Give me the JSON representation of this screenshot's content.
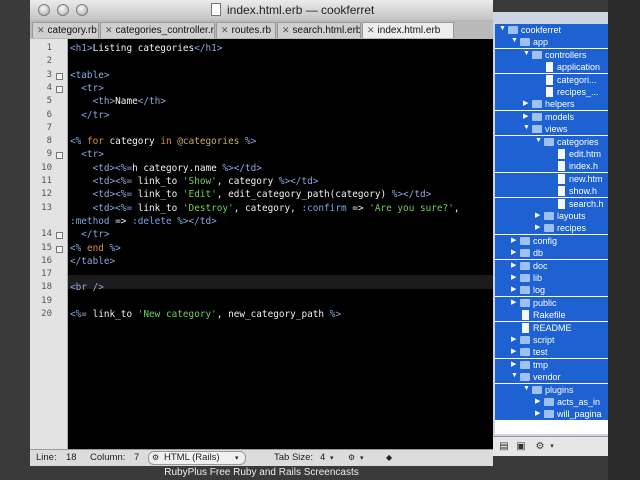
{
  "window": {
    "title": "index.html.erb — cookferret",
    "tabs": [
      {
        "label": "category.rb"
      },
      {
        "label": "categories_controller.rb"
      },
      {
        "label": "routes.rb"
      },
      {
        "label": "search.html.erb"
      },
      {
        "label": "index.html.erb",
        "active": true
      }
    ]
  },
  "editor": {
    "line_numbers": [
      "1",
      "2",
      "3",
      "4",
      "5",
      "6",
      "7",
      "8",
      "9",
      "10",
      "11",
      "12",
      "13",
      "",
      "14",
      "15",
      "16",
      "17",
      "18",
      "19",
      "20"
    ],
    "lines": [
      {
        "parts": [
          {
            "c": "t",
            "x": "<h1>"
          },
          {
            "c": "",
            "x": "Listing categories"
          },
          {
            "c": "t",
            "x": "</h1>"
          }
        ]
      },
      {
        "parts": []
      },
      {
        "parts": [
          {
            "c": "t",
            "x": "<table>"
          }
        ]
      },
      {
        "parts": [
          {
            "c": "t",
            "x": "  <tr>"
          }
        ]
      },
      {
        "parts": [
          {
            "c": "t",
            "x": "    <th>"
          },
          {
            "c": "",
            "x": "Name"
          },
          {
            "c": "t",
            "x": "</th>"
          }
        ]
      },
      {
        "parts": [
          {
            "c": "t",
            "x": "  </tr>"
          }
        ]
      },
      {
        "parts": []
      },
      {
        "parts": [
          {
            "c": "t",
            "x": "<%"
          },
          {
            "c": "k",
            "x": " for "
          },
          {
            "c": "",
            "x": "category "
          },
          {
            "c": "k",
            "x": "in "
          },
          {
            "c": "v",
            "x": "@categories"
          },
          {
            "c": "t",
            "x": " %>"
          }
        ]
      },
      {
        "parts": [
          {
            "c": "t",
            "x": "  <tr>"
          }
        ]
      },
      {
        "parts": [
          {
            "c": "t",
            "x": "    <td><%="
          },
          {
            "c": "",
            "x": "h category.name "
          },
          {
            "c": "t",
            "x": "%></td>"
          }
        ]
      },
      {
        "parts": [
          {
            "c": "t",
            "x": "    <td><%="
          },
          {
            "c": "",
            "x": " link_to "
          },
          {
            "c": "s",
            "x": "'Show'"
          },
          {
            "c": "",
            "x": ", category "
          },
          {
            "c": "t",
            "x": "%></td>"
          }
        ]
      },
      {
        "parts": [
          {
            "c": "t",
            "x": "    <td><%="
          },
          {
            "c": "",
            "x": " link_to "
          },
          {
            "c": "s",
            "x": "'Edit'"
          },
          {
            "c": "",
            "x": ", edit_category_path(category) "
          },
          {
            "c": "t",
            "x": "%></td>"
          }
        ]
      },
      {
        "parts": [
          {
            "c": "t",
            "x": "    <td><%="
          },
          {
            "c": "",
            "x": " link_to "
          },
          {
            "c": "s",
            "x": "'Destroy'"
          },
          {
            "c": "",
            "x": ", category, "
          },
          {
            "c": "sym",
            "x": ":confirm"
          },
          {
            "c": "",
            "x": " => "
          },
          {
            "c": "s",
            "x": "'Are you sure?'"
          },
          {
            "c": "",
            "x": ","
          }
        ]
      },
      {
        "parts": [
          {
            "c": "sym",
            "x": ":method"
          },
          {
            "c": "",
            "x": " => "
          },
          {
            "c": "sym",
            "x": ":delete"
          },
          {
            "c": "t",
            "x": " %></td>"
          }
        ]
      },
      {
        "parts": [
          {
            "c": "t",
            "x": "  </tr>"
          }
        ]
      },
      {
        "parts": [
          {
            "c": "t",
            "x": "<%"
          },
          {
            "c": "k",
            "x": " end "
          },
          {
            "c": "t",
            "x": "%>"
          }
        ]
      },
      {
        "parts": [
          {
            "c": "t",
            "x": "</table>"
          }
        ]
      },
      {
        "parts": []
      },
      {
        "parts": [
          {
            "c": "t",
            "x": "<br />"
          }
        ]
      },
      {
        "parts": []
      },
      {
        "parts": [
          {
            "c": "t",
            "x": "<%="
          },
          {
            "c": "",
            "x": " link_to "
          },
          {
            "c": "s",
            "x": "'New category'"
          },
          {
            "c": "",
            "x": ", new_category_path "
          },
          {
            "c": "t",
            "x": "%>"
          }
        ]
      }
    ]
  },
  "status": {
    "line_label": "Line:",
    "line_value": "18",
    "column_label": "Column:",
    "column_value": "7",
    "language": "HTML (Rails)",
    "tab_size_label": "Tab Size:",
    "tab_size_value": "4"
  },
  "drawer": {
    "items": [
      {
        "label": "cookferret",
        "depth": 0,
        "kind": "folder",
        "open": true
      },
      {
        "label": "app",
        "depth": 1,
        "kind": "folder",
        "open": true
      },
      {
        "label": "controllers",
        "depth": 2,
        "kind": "folder",
        "open": true
      },
      {
        "label": "application",
        "depth": 3,
        "kind": "file"
      },
      {
        "label": "categori...",
        "depth": 3,
        "kind": "file"
      },
      {
        "label": "recipes_...",
        "depth": 3,
        "kind": "file"
      },
      {
        "label": "helpers",
        "depth": 2,
        "kind": "folder",
        "open": false
      },
      {
        "label": "models",
        "depth": 2,
        "kind": "folder",
        "open": false
      },
      {
        "label": "views",
        "depth": 2,
        "kind": "folder",
        "open": true
      },
      {
        "label": "categories",
        "depth": 3,
        "kind": "folder",
        "open": true
      },
      {
        "label": "edit.htm",
        "depth": 4,
        "kind": "file"
      },
      {
        "label": "index.h",
        "depth": 4,
        "kind": "file"
      },
      {
        "label": "new.htm",
        "depth": 4,
        "kind": "file"
      },
      {
        "label": "show.h",
        "depth": 4,
        "kind": "file"
      },
      {
        "label": "search.h",
        "depth": 4,
        "kind": "file"
      },
      {
        "label": "layouts",
        "depth": 3,
        "kind": "folder",
        "open": false
      },
      {
        "label": "recipes",
        "depth": 3,
        "kind": "folder",
        "open": false
      },
      {
        "label": "config",
        "depth": 1,
        "kind": "folder",
        "open": false
      },
      {
        "label": "db",
        "depth": 1,
        "kind": "folder",
        "open": false
      },
      {
        "label": "doc",
        "depth": 1,
        "kind": "folder",
        "open": false
      },
      {
        "label": "lib",
        "depth": 1,
        "kind": "folder",
        "open": false
      },
      {
        "label": "log",
        "depth": 1,
        "kind": "folder",
        "open": false
      },
      {
        "label": "public",
        "depth": 1,
        "kind": "folder",
        "open": false
      },
      {
        "label": "Rakefile",
        "depth": 1,
        "kind": "file"
      },
      {
        "label": "README",
        "depth": 1,
        "kind": "file"
      },
      {
        "label": "script",
        "depth": 1,
        "kind": "folder",
        "open": false
      },
      {
        "label": "test",
        "depth": 1,
        "kind": "folder",
        "open": false
      },
      {
        "label": "tmp",
        "depth": 1,
        "kind": "folder",
        "open": false
      },
      {
        "label": "vendor",
        "depth": 1,
        "kind": "folder",
        "open": true
      },
      {
        "label": "plugins",
        "depth": 2,
        "kind": "folder",
        "open": true
      },
      {
        "label": "acts_as_in",
        "depth": 3,
        "kind": "folder",
        "open": false
      },
      {
        "label": "will_pagina",
        "depth": 3,
        "kind": "folder",
        "open": false
      }
    ]
  },
  "caption": "RubyPlus Free Ruby and Rails Screencasts",
  "colors": {
    "accent": "#1d61d2",
    "editor_bg": "#000000"
  }
}
